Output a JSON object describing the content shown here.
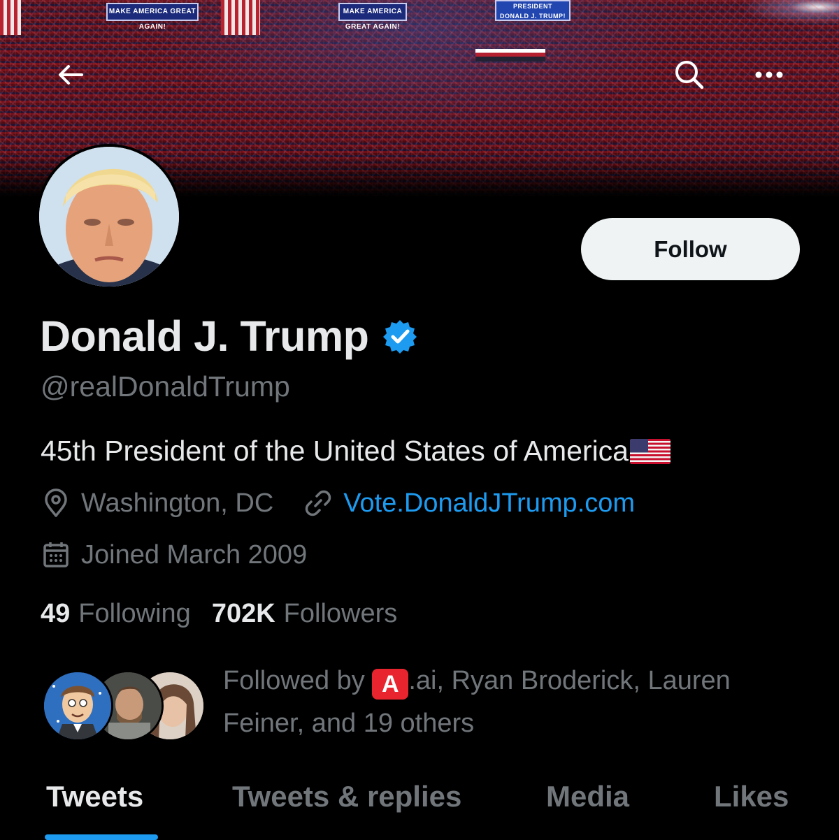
{
  "banner": {
    "sign_left": "MAKE AMERICA GREAT AGAIN!",
    "sign_mid": "MAKE AMERICA GREAT AGAIN!",
    "sign_right_line1": "PRESIDENT",
    "sign_right_line2": "DONALD J. TRUMP!"
  },
  "header": {
    "back_icon": "arrow-left-icon",
    "search_icon": "search-icon",
    "more_icon": "more-horizontal-icon"
  },
  "profile": {
    "follow_label": "Follow",
    "display_name": "Donald J. Trump",
    "verified_icon": "verified-badge-icon",
    "handle": "@realDonaldTrump",
    "bio": "45th President of the United States of America",
    "bio_emoji": "us-flag-emoji",
    "location": "Washington, DC",
    "website": "Vote.DonaldJTrump.com",
    "joined": "Joined March 2009",
    "following_count": "49",
    "following_label": "Following",
    "followers_count": "702K",
    "followers_label": "Followers",
    "followed_by_prefix": "Followed by ",
    "followed_by_badge": "A",
    "followed_by_rest": ".ai, Ryan Broderick, Lauren Feiner, and 19 others"
  },
  "tabs": [
    {
      "label": "Tweets",
      "active": true
    },
    {
      "label": "Tweets & replies",
      "active": false
    },
    {
      "label": "Media",
      "active": false
    },
    {
      "label": "Likes",
      "active": false
    }
  ],
  "colors": {
    "background": "#000000",
    "accent": "#1d9bf0",
    "text_primary": "#e7e9ea",
    "text_secondary": "#71767b",
    "follow_button_bg": "#eff3f4"
  }
}
